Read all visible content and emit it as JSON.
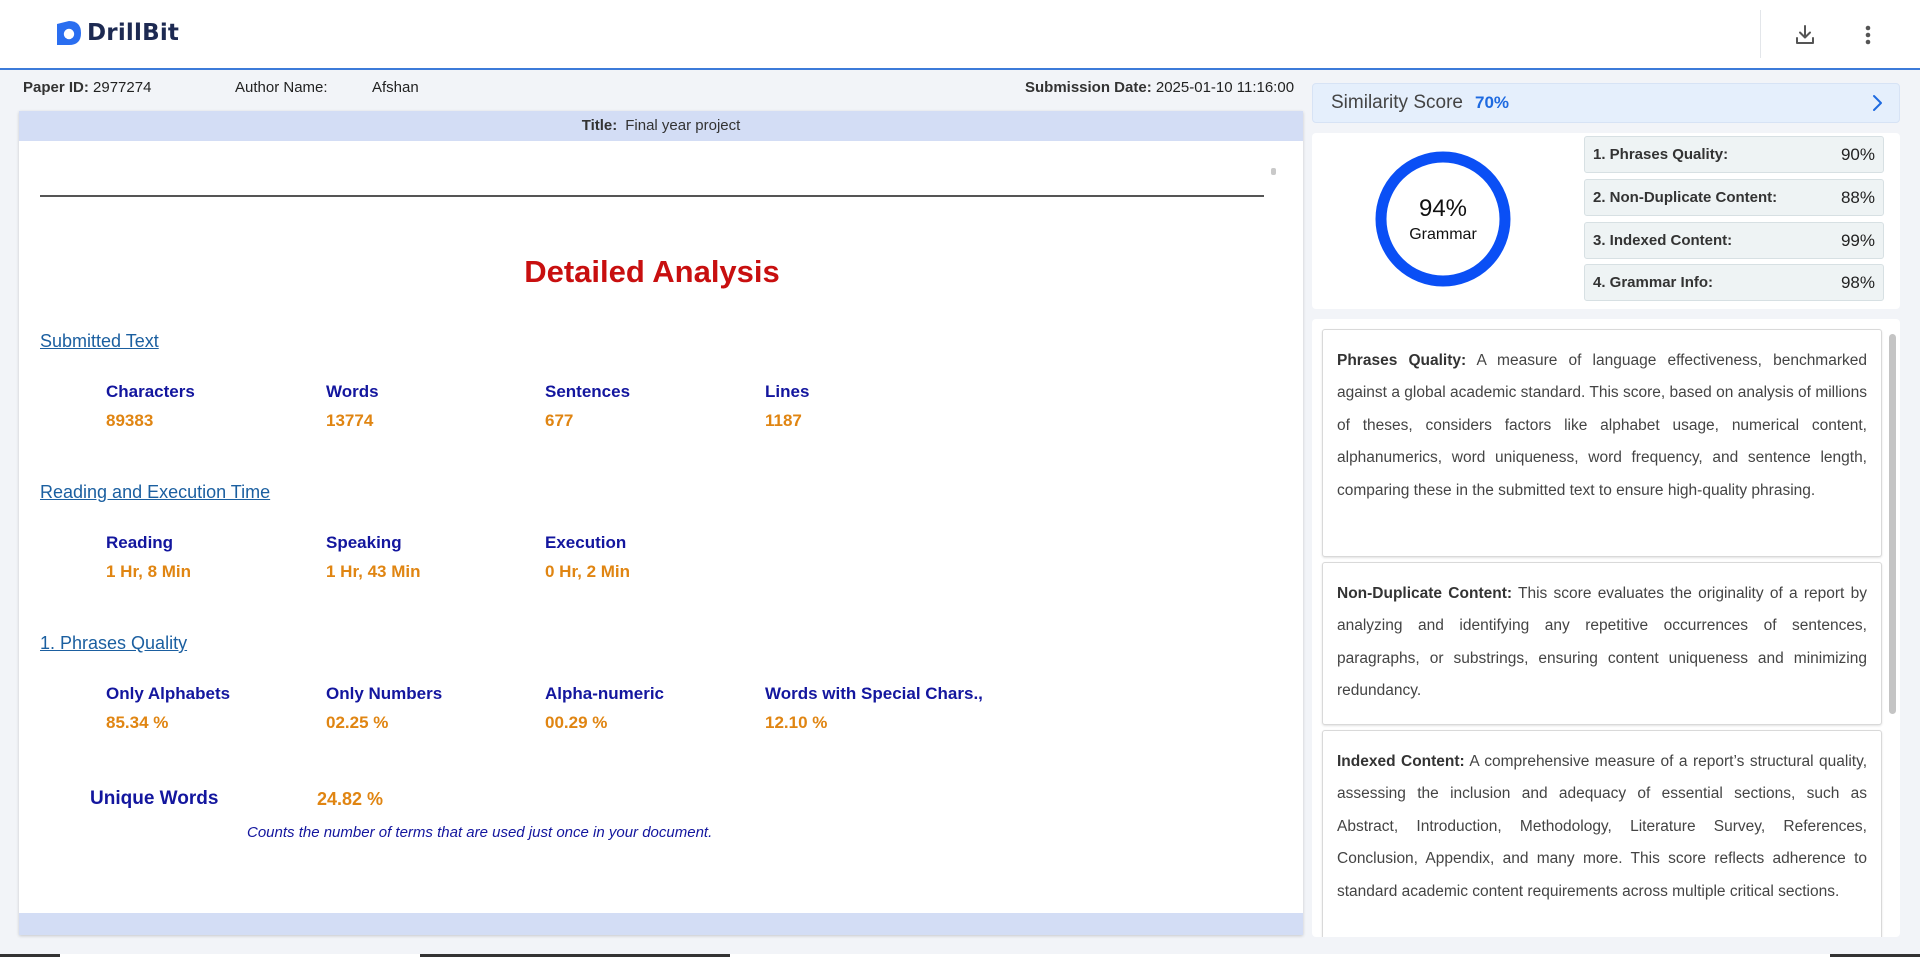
{
  "app": {
    "name": "DrillBit"
  },
  "header": {
    "download_icon": "download-icon",
    "menu_icon": "more-vert-icon"
  },
  "meta": {
    "paper_id_label": "Paper ID:",
    "paper_id": "2977274",
    "author_label": "Author Name:",
    "author": "Afshan",
    "submission_label": "Submission Date:",
    "submission_date": "2025-01-10 11:16:00"
  },
  "document": {
    "title_label": "Title:",
    "title": "Final year project",
    "heading": "Detailed Analysis",
    "sections": {
      "submitted_text": {
        "title": "Submitted Text",
        "stats": [
          {
            "label": "Characters",
            "value": "89383"
          },
          {
            "label": "Words",
            "value": "13774"
          },
          {
            "label": "Sentences",
            "value": "677"
          },
          {
            "label": "Lines",
            "value": "1187"
          }
        ]
      },
      "reading_time": {
        "title": "Reading and Execution Time",
        "stats": [
          {
            "label": "Reading",
            "value": "1 Hr, 8 Min"
          },
          {
            "label": "Speaking",
            "value": "1 Hr, 43 Min"
          },
          {
            "label": "Execution",
            "value": "0 Hr, 2 Min"
          }
        ]
      },
      "phrases_quality": {
        "title": "1. Phrases Quality",
        "stats": [
          {
            "label": "Only Alphabets",
            "value": "85.34 %"
          },
          {
            "label": "Only Numbers",
            "value": "02.25 %"
          },
          {
            "label": "Alpha-numeric",
            "value": "00.29 %"
          },
          {
            "label": "Words with Special Chars.,",
            "value": "12.10 %"
          }
        ],
        "unique_words_label": "Unique Words",
        "unique_words_value": "24.82 %",
        "unique_words_note": "Counts the number of terms that are used just once in your document."
      }
    }
  },
  "sidebar": {
    "similarity_label": "Similarity Score",
    "similarity_value": "70%",
    "grammar_gauge": {
      "percent": 94,
      "percent_text": "94%",
      "label": "Grammar"
    },
    "metrics": [
      {
        "label": "1. Phrases Quality:",
        "value": "90%"
      },
      {
        "label": "2. Non-Duplicate Content:",
        "value": "88%"
      },
      {
        "label": "3. Indexed Content:",
        "value": "99%"
      },
      {
        "label": "4. Grammar Info:",
        "value": "98%"
      }
    ],
    "descriptions": [
      {
        "title": "Phrases Quality:",
        "text": "A measure of language effectiveness, benchmarked against a global academic standard. This score, based on analysis of millions of theses, considers factors like alphabet usage, numerical content, alphanumerics, word uniqueness, word frequency, and sentence length, comparing these in the submitted text to ensure high-quality phrasing."
      },
      {
        "title": "Non-Duplicate Content:",
        "text": "This score evaluates the originality of a report by analyzing and identifying any repetitive occurrences of sentences, paragraphs, or substrings, ensuring content uniqueness and minimizing redundancy."
      },
      {
        "title": "Indexed Content:",
        "text": "A comprehensive measure of a report’s structural quality, assessing the inclusion and adequacy of essential sections, such as Abstract, Introduction, Methodology, Literature Survey, References, Conclusion, Appendix, and many more. This score reflects adherence to standard academic content requirements across multiple critical sections."
      }
    ]
  },
  "colors": {
    "accent": "#1e6ae0",
    "heading_red": "#c80f0f",
    "label_navy": "#13169e",
    "value_orange": "#e08512",
    "title_bar": "#d3ddf5",
    "gauge_track": "#0a4ff5"
  }
}
